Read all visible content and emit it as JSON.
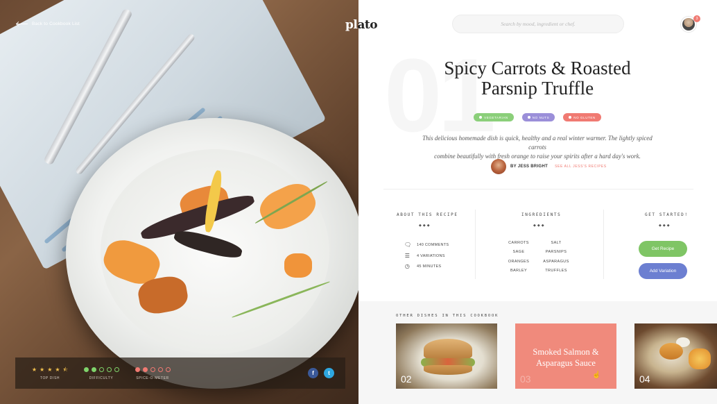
{
  "nav": {
    "back_label": "Back to Cookbook List",
    "logo_left": "pl",
    "logo_right": "ato",
    "search_placeholder": "Search by mood, ingredient or chef.",
    "notification_count": "3"
  },
  "recipe": {
    "number": "01",
    "title_line1": "Spicy Carrots & Roasted",
    "title_line2": "Parsnip Truffle",
    "tags": [
      {
        "label": "Vegetarian",
        "color": "#8bcf7a"
      },
      {
        "label": "No Nuts",
        "color": "#9b8fd9"
      },
      {
        "label": "No Gluten",
        "color": "#f07a72"
      }
    ],
    "description_line1": "This delicious homemade dish is quick, healthy and a real winter warmer. The lightly spiced carrots",
    "description_line2": "combine beautifully with fresh orange to raise your spirits after a hard day's work.",
    "author_label": "BY JESS BRIGHT",
    "author_link": "SEE ALL JESS'S RECIPES"
  },
  "about": {
    "title": "ABOUT THIS RECIPE",
    "diamonds": "◆◆◆",
    "items": [
      {
        "icon": "comments-icon",
        "label": "140 COMMENTS"
      },
      {
        "icon": "variations-icon",
        "label": "4 VARIATIONS"
      },
      {
        "icon": "clock-icon",
        "label": "45 MINUTES"
      }
    ]
  },
  "ingredients": {
    "title": "INGREDIENTS",
    "diamonds": "◆◆◆",
    "left": [
      "CARROTS",
      "SAGE",
      "ORANGES",
      "BARLEY"
    ],
    "right": [
      "SALT",
      "PARSNIPS",
      "ASPARAGUS",
      "TRUFFLES"
    ]
  },
  "get_started": {
    "title": "GET STARTED!",
    "diamonds": "◆◆◆",
    "primary": "Get Recipe",
    "secondary": "Add Variation",
    "primary_color": "#7fc565",
    "secondary_color": "#6c7fd1"
  },
  "ratings": {
    "top_dish": {
      "caption": "TOP DISH",
      "stars": 4.5,
      "max": 5
    },
    "difficulty": {
      "caption": "DIFFICULTY",
      "level": 2,
      "max": 5
    },
    "spice": {
      "caption": "SPICE-O-METER",
      "level": 2,
      "max": 5
    }
  },
  "other_dishes": {
    "title": "OTHER DISHES IN THIS COOKBOOK",
    "cards": [
      {
        "number": "02",
        "title": ""
      },
      {
        "number": "03",
        "title_line1": "Smoked Salmon &",
        "title_line2": "Asparagus Sauce"
      },
      {
        "number": "04",
        "title": ""
      }
    ]
  },
  "colors": {
    "accent_red": "#f07a72",
    "accent_green": "#7fc565",
    "accent_blue": "#6c7fd1",
    "facebook": "#3b5998",
    "twitter": "#2ea7e0"
  }
}
